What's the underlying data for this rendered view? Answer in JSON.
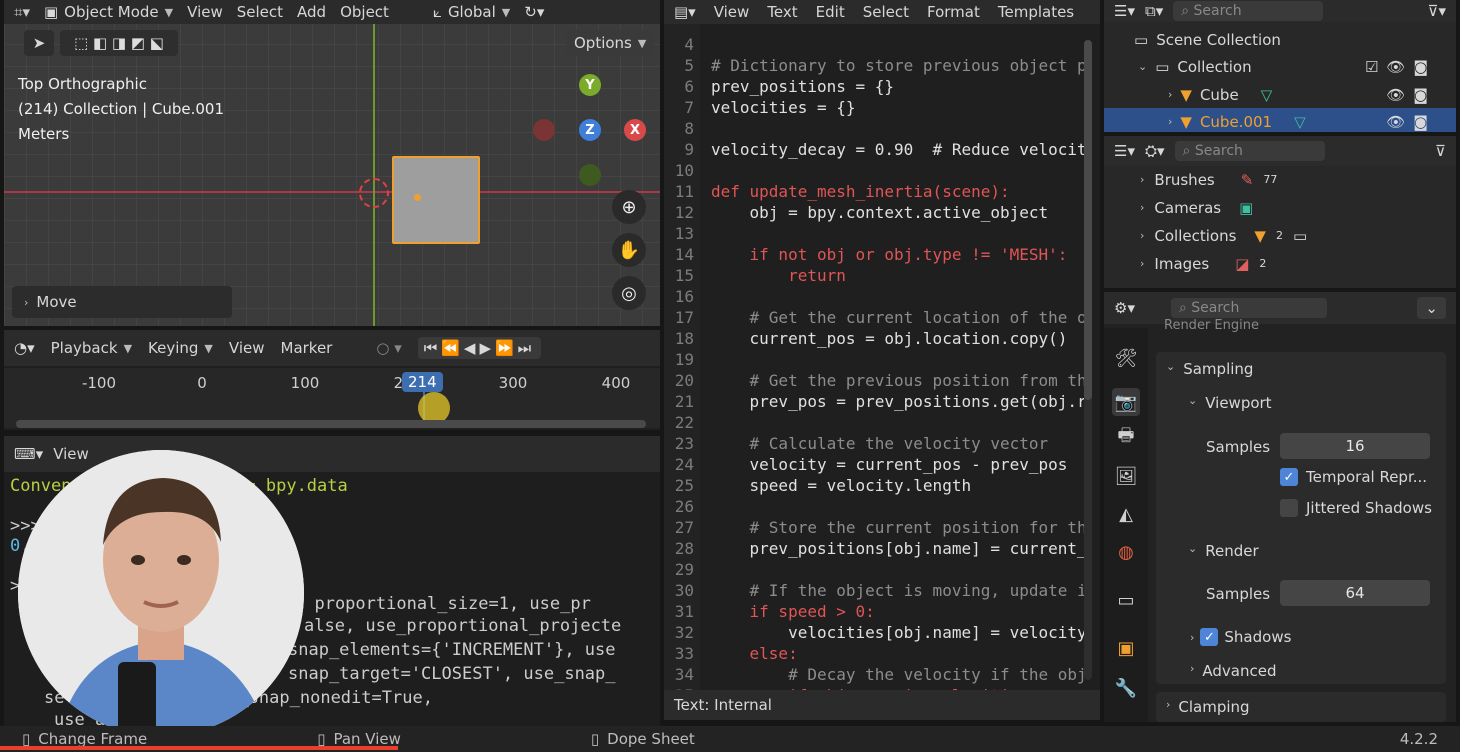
{
  "viewport": {
    "mode_label": "Object Mode",
    "menus": [
      "View",
      "Select",
      "Add",
      "Object"
    ],
    "orientation_label": "Global",
    "options_label": "Options",
    "info": [
      "Top Orthographic",
      "(214) Collection | Cube.001",
      "Meters"
    ],
    "gizmo": {
      "y": "Y",
      "z": "Z",
      "x": "X"
    },
    "operator_panel": "Move"
  },
  "timeline": {
    "playback_label": "Playback",
    "keying_label": "Keying",
    "view_label": "View",
    "marker_label": "Marker",
    "ticks": [
      "-100",
      "0",
      "100",
      "200",
      "300",
      "400"
    ],
    "current_frame": "214"
  },
  "console": {
    "view_label": "View",
    "lines": [
      "Conveni bpy.context, D = bpy.data",
      ">>>",
      "0.",
      ">",
      "  , proportional_size=1, use_pr",
      "alse, use_proportional_projecte",
      "snap_elements={'INCREMENT'}, use",
      "snap_target='CLOSEST', use_snap_",
      "se    p_edit=True, use_snap_nonedit=True,",
      "use     able=False)"
    ]
  },
  "editor": {
    "menus": [
      "View",
      "Text",
      "Edit",
      "Select",
      "Format",
      "Templates"
    ],
    "footer": "Text: Internal",
    "lines": [
      {
        "n": "4",
        "code": ""
      },
      {
        "n": "5",
        "code": "# Dictionary to store previous object p"
      },
      {
        "n": "6",
        "code": "prev_positions = {}"
      },
      {
        "n": "7",
        "code": "velocities = {}"
      },
      {
        "n": "8",
        "code": ""
      },
      {
        "n": "9",
        "code": "velocity_decay = 0.90  # Reduce velocit"
      },
      {
        "n": "10",
        "code": ""
      },
      {
        "n": "11",
        "code": "def update_mesh_inertia(scene):"
      },
      {
        "n": "12",
        "code": "    obj = bpy.context.active_object"
      },
      {
        "n": "13",
        "code": ""
      },
      {
        "n": "14",
        "code": "    if not obj or obj.type != 'MESH':"
      },
      {
        "n": "15",
        "code": "        return"
      },
      {
        "n": "16",
        "code": ""
      },
      {
        "n": "17",
        "code": "    # Get the current location of the o"
      },
      {
        "n": "18",
        "code": "    current_pos = obj.location.copy()"
      },
      {
        "n": "19",
        "code": ""
      },
      {
        "n": "20",
        "code": "    # Get the previous position from th"
      },
      {
        "n": "21",
        "code": "    prev_pos = prev_positions.get(obj.r"
      },
      {
        "n": "22",
        "code": ""
      },
      {
        "n": "23",
        "code": "    # Calculate the velocity vector"
      },
      {
        "n": "24",
        "code": "    velocity = current_pos - prev_pos"
      },
      {
        "n": "25",
        "code": "    speed = velocity.length"
      },
      {
        "n": "26",
        "code": ""
      },
      {
        "n": "27",
        "code": "    # Store the current position for th"
      },
      {
        "n": "28",
        "code": "    prev_positions[obj.name] = current_"
      },
      {
        "n": "29",
        "code": ""
      },
      {
        "n": "30",
        "code": "    # If the object is moving, update i"
      },
      {
        "n": "31",
        "code": "    if speed > 0:"
      },
      {
        "n": "32",
        "code": "        velocities[obj.name] = velocity"
      },
      {
        "n": "33",
        "code": "    else:"
      },
      {
        "n": "34",
        "code": "        # Decay the velocity if the obj"
      },
      {
        "n": "35",
        "code": "        if obj.name in velocities:"
      }
    ]
  },
  "outliner": {
    "search_placeholder": "Search",
    "scene_collection": "Scene Collection",
    "collection": "Collection",
    "cube": "Cube",
    "cube_001": "Cube.001"
  },
  "databrowser": {
    "search_placeholder": "Search",
    "items": [
      "Brushes",
      "Cameras",
      "Collections",
      "Images"
    ],
    "badges": {
      "brushes": "77",
      "collections": "2",
      "images": "2"
    }
  },
  "properties": {
    "search_placeholder": "Search",
    "render_engine_cut": "Render Engine",
    "sampling_label": "Sampling",
    "viewport_label": "Viewport",
    "samples_label": "Samples",
    "viewport_samples": "16",
    "temporal_label": "Temporal Repr...",
    "jittered_label": "Jittered Shadows",
    "render_label": "Render",
    "render_samples": "64",
    "shadows_label": "Shadows",
    "advanced_label": "Advanced",
    "clamping_label": "Clamping"
  },
  "statusbar": {
    "change_frame": "Change Frame",
    "pan_view": "Pan View",
    "dope_sheet": "Dope Sheet",
    "version": "4.2.2"
  },
  "colors": {
    "accent": "#4f85d6",
    "selection": "#f0a030",
    "x_axis": "#d84a4a",
    "y_axis": "#7bab2a",
    "z_axis": "#3f7fd9"
  }
}
